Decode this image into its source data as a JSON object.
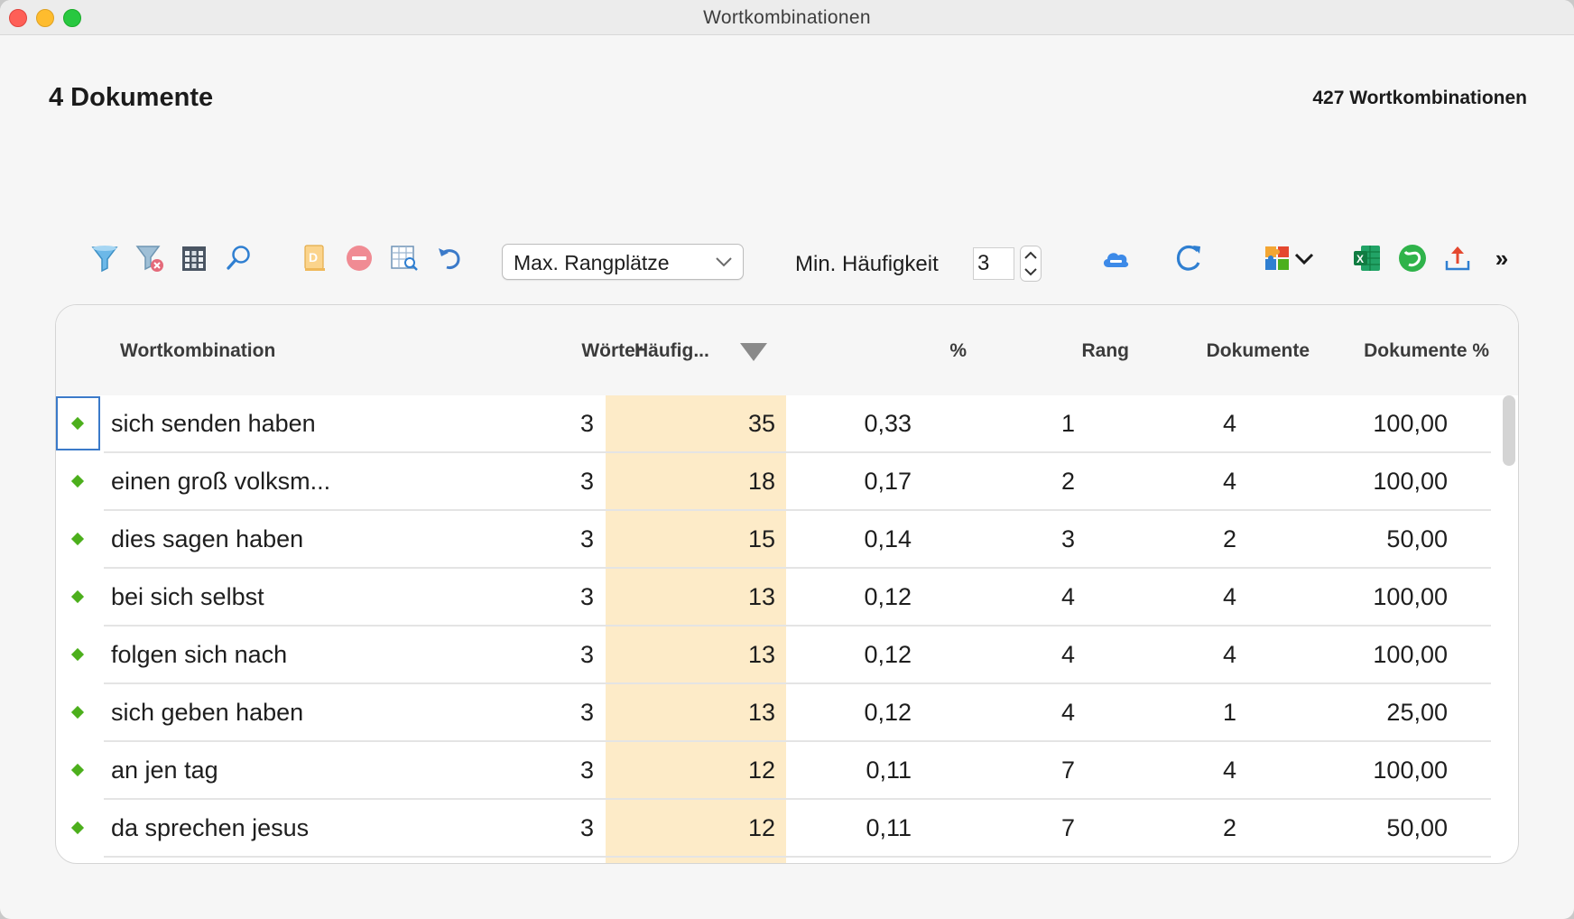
{
  "window": {
    "title": "Wortkombinationen"
  },
  "header": {
    "documents": "4 Dokumente",
    "combinations": "427 Wortkombinationen"
  },
  "toolbar": {
    "rank_select": "Max. Rangplätze",
    "min_freq_label": "Min. Häufigkeit",
    "min_freq_value": "3",
    "more": "»",
    "icons": [
      "filter-icon",
      "clear-filter-icon",
      "columns-icon",
      "search-icon",
      "document-icon",
      "remove-icon",
      "table-search-icon",
      "undo-icon",
      "cloud-icon",
      "refresh-icon",
      "puzzle-icon",
      "excel-icon",
      "spss-icon",
      "export-icon"
    ]
  },
  "table": {
    "columns": {
      "combination": "Wortkombination",
      "words": "Wörter",
      "frequency": "Häufig...",
      "percent": "%",
      "rank": "Rang",
      "documents": "Dokumente",
      "documents_percent": "Dokumente %"
    },
    "rows": [
      {
        "combination": "sich senden haben",
        "words": "3",
        "frequency": "35",
        "percent": "0,33",
        "rank": "1",
        "documents": "4",
        "documents_percent": "100,00"
      },
      {
        "combination": "einen groß volksm...",
        "words": "3",
        "frequency": "18",
        "percent": "0,17",
        "rank": "2",
        "documents": "4",
        "documents_percent": "100,00"
      },
      {
        "combination": "dies sagen haben",
        "words": "3",
        "frequency": "15",
        "percent": "0,14",
        "rank": "3",
        "documents": "2",
        "documents_percent": "50,00"
      },
      {
        "combination": "bei sich selbst",
        "words": "3",
        "frequency": "13",
        "percent": "0,12",
        "rank": "4",
        "documents": "4",
        "documents_percent": "100,00"
      },
      {
        "combination": "folgen sich nach",
        "words": "3",
        "frequency": "13",
        "percent": "0,12",
        "rank": "4",
        "documents": "4",
        "documents_percent": "100,00"
      },
      {
        "combination": "sich geben haben",
        "words": "3",
        "frequency": "13",
        "percent": "0,12",
        "rank": "4",
        "documents": "1",
        "documents_percent": "25,00"
      },
      {
        "combination": "an jen tag",
        "words": "3",
        "frequency": "12",
        "percent": "0,11",
        "rank": "7",
        "documents": "4",
        "documents_percent": "100,00"
      },
      {
        "combination": "da sprechen jesus",
        "words": "3",
        "frequency": "12",
        "percent": "0,11",
        "rank": "7",
        "documents": "2",
        "documents_percent": "50,00"
      }
    ]
  },
  "colors": {
    "accent_blue": "#3b7ac9",
    "frequency_highlight": "#fdebc8",
    "bullet_green": "#4caf1c"
  }
}
